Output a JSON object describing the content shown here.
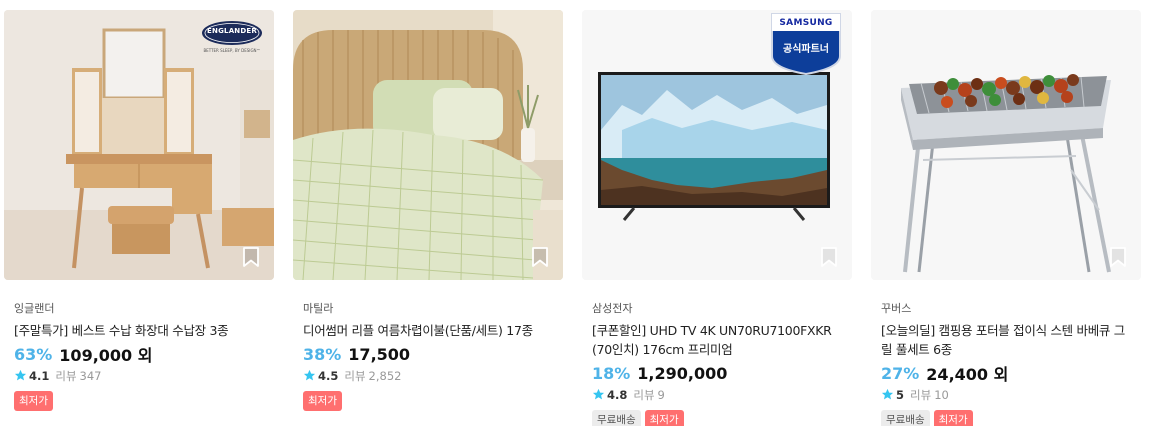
{
  "colors": {
    "discount": "#4fb3e8",
    "lowest_badge": "#ff6f6f",
    "free_badge": "#ececec"
  },
  "products": [
    {
      "brand": "잉글랜더",
      "title": "[주말특가] 베스트 수납 화장대 수납장 3종",
      "discount": "63%",
      "price": "109,000 외",
      "rating": "4.1",
      "review_label": "리뷰",
      "review_count": "347",
      "badges": [
        "최저가"
      ],
      "logo_text": "ENGLANDER",
      "logo_sub": "BETTER SLEEP, BY DESIGN™",
      "image_icon": "vanity-table-image"
    },
    {
      "brand": "마틸라",
      "title": "디어썸머 리플 여름차렵이불(단품/세트) 17종",
      "discount": "38%",
      "price": "17,500",
      "rating": "4.5",
      "review_label": "리뷰",
      "review_count": "2,852",
      "badges": [
        "최저가"
      ],
      "image_icon": "bedding-image"
    },
    {
      "brand": "삼성전자",
      "title": "[쿠폰할인] UHD TV 4K UN70RU7100FXKR (70인치) 176cm 프리미엄",
      "discount": "18%",
      "price": "1,290,000",
      "rating": "4.8",
      "review_label": "리뷰",
      "review_count": "9",
      "badges": [
        "무료배송",
        "최저가"
      ],
      "logo_text": "SAMSUNG",
      "logo_sub": "공식파트너",
      "image_icon": "tv-image"
    },
    {
      "brand": "꾸버스",
      "title": "[오늘의딜] 캠핑용 포터블 접이식 스텐 바베큐 그릴 풀세트 6종",
      "discount": "27%",
      "price": "24,400 외",
      "rating": "5",
      "review_label": "리뷰",
      "review_count": "10",
      "badges": [
        "무료배송",
        "최저가"
      ],
      "image_icon": "bbq-grill-image"
    }
  ]
}
